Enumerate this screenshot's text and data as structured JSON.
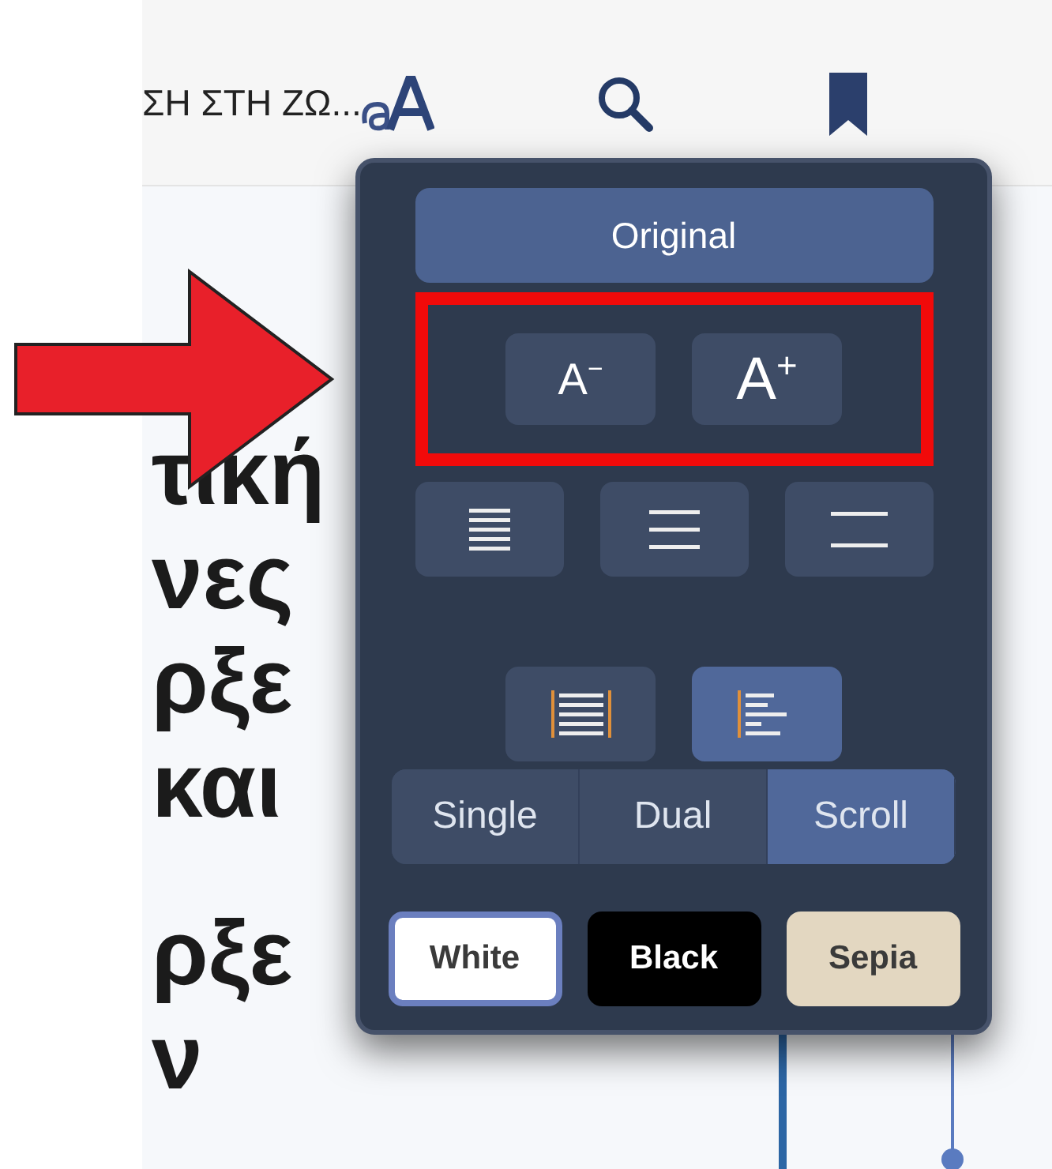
{
  "top_bar": {
    "title": "ΣΗ ΣΤΗ ΖΩ..."
  },
  "page_text": {
    "lines": [
      "τική",
      "νες",
      "ρξε",
      "και",
      "ρξε",
      "ν"
    ]
  },
  "settings_popup": {
    "original_button": "Original",
    "font_size_buttons": [
      {
        "label": "A$^{−}$",
        "kind": "smaller"
      },
      {
        "label": "A$^{+}$",
        "kind": "larger"
      }
    ],
    "line_spacing_buttons": [
      {
        "kind": "tight"
      },
      {
        "kind": "normal"
      },
      {
        "kind": "wide"
      }
    ],
    "alignment_buttons": [
      {
        "kind": "justify",
        "selected": false
      },
      {
        "kind": "left",
        "selected": true
      }
    ],
    "page_modes": [
      {
        "label": "Single",
        "selected": false
      },
      {
        "label": "Dual",
        "selected": false
      },
      {
        "label": "Scroll",
        "selected": true
      }
    ],
    "themes": [
      {
        "label": "White",
        "color": "#ffffff",
        "selected": true
      },
      {
        "label": "Black",
        "color": "#000000",
        "selected": false
      },
      {
        "label": "Sepia",
        "color": "#e3d7c1",
        "selected": false
      }
    ]
  },
  "annotation": {
    "arrow": true,
    "highlight_box": true
  }
}
